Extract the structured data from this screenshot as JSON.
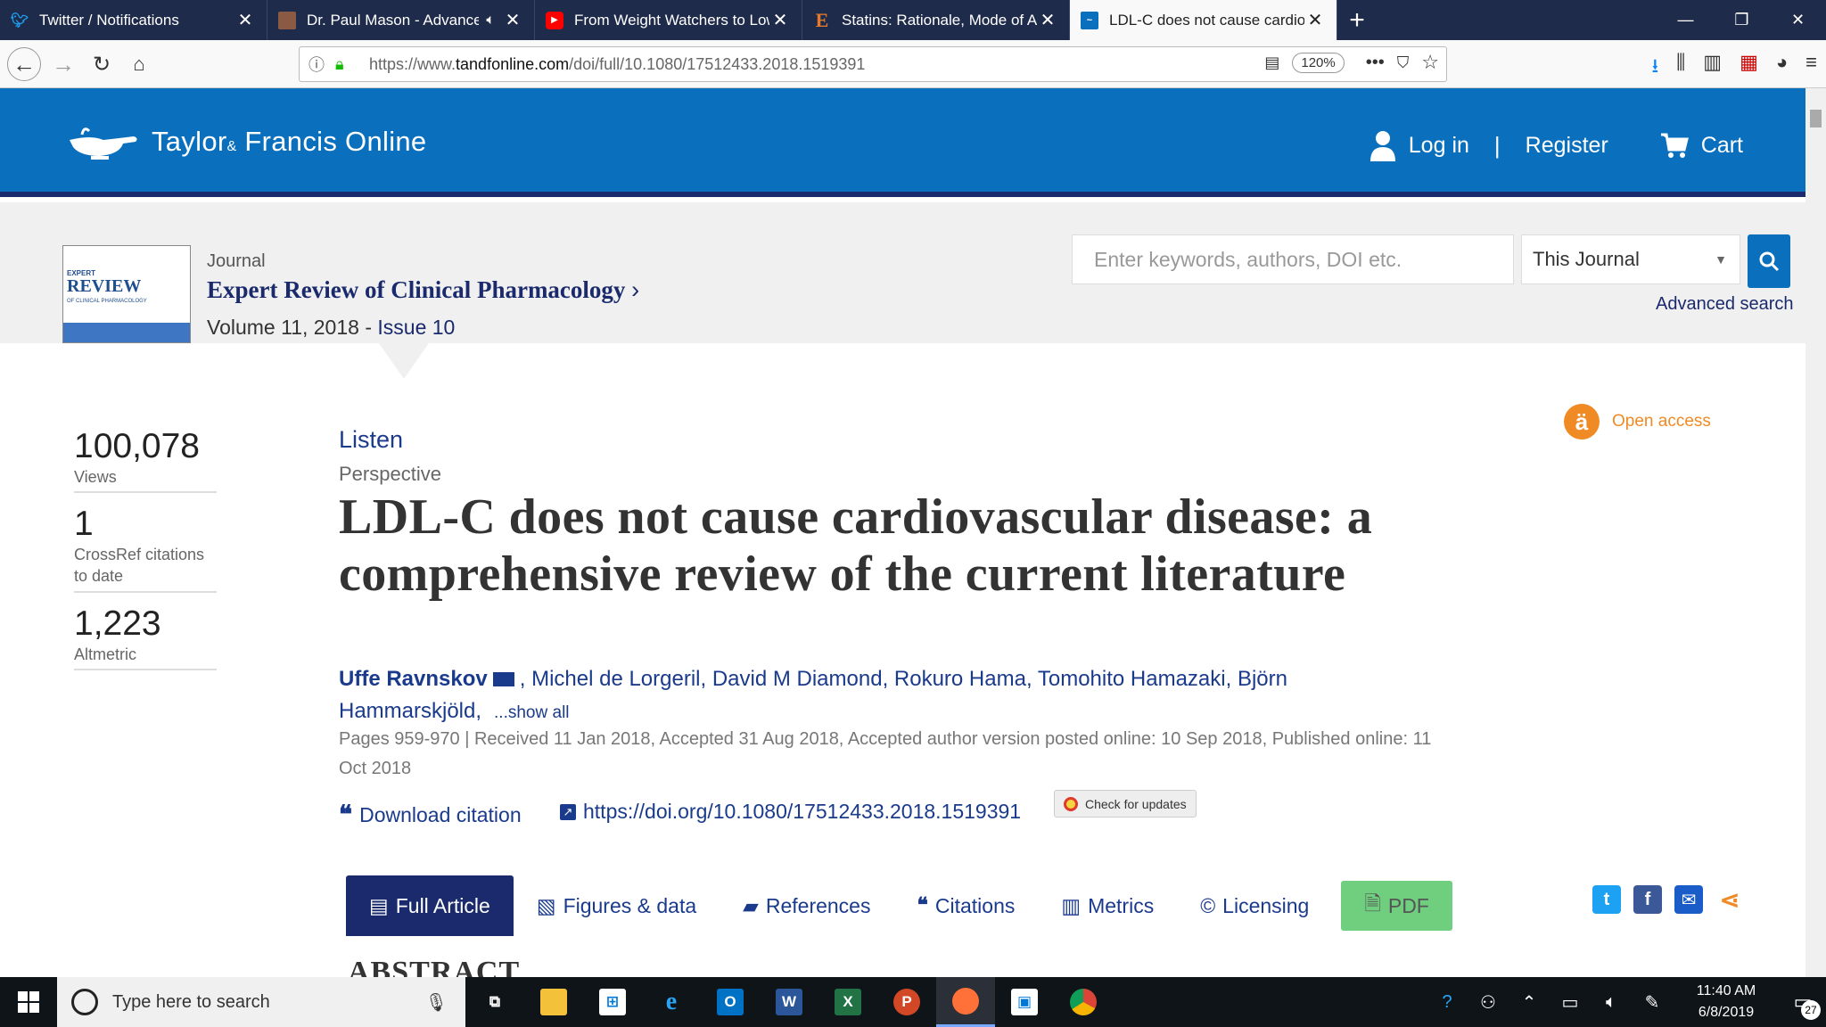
{
  "browser": {
    "tabs": [
      {
        "title": "Twitter / Notifications",
        "icon": "twitter-icon",
        "active": false,
        "audio": false
      },
      {
        "title": "Dr. Paul Mason - Advanced",
        "icon": "youtube-thumb-icon",
        "active": false,
        "audio": true
      },
      {
        "title": "From Weight Watchers to Low",
        "icon": "youtube-icon",
        "active": false,
        "audio": false
      },
      {
        "title": "Statins: Rationale, Mode of Acti",
        "icon": "e-site-icon",
        "active": false,
        "audio": false
      },
      {
        "title": "LDL-C does not cause cardiova",
        "icon": "tandf-icon",
        "active": true,
        "audio": false
      }
    ],
    "url_prefix": "https://www.",
    "url_domain": "tandfonline.com",
    "url_path": "/doi/full/10.1080/17512433.2018.1519391",
    "zoom": "120%"
  },
  "site": {
    "brand": "Taylor",
    "brand_amp": "&",
    "brand_rest": "Francis Online",
    "login": "Log in",
    "register": "Register",
    "cart": "Cart",
    "header_color": "#0a70bd"
  },
  "journal": {
    "label": "Journal",
    "name": "Expert Review of Clinical Pharmacology",
    "volume": "Volume 11, 2018",
    "volume_sep": " - ",
    "issue": "Issue 10",
    "cover_small": "EXPERT",
    "cover_big": "REVIEW",
    "cover_sub": "OF CLINICAL PHARMACOLOGY"
  },
  "search": {
    "placeholder": "Enter keywords, authors, DOI etc.",
    "scope": "This Journal",
    "advanced": "Advanced search"
  },
  "metrics": [
    {
      "value": "100,078",
      "label": "Views"
    },
    {
      "value": "1",
      "label": "CrossRef citations to date"
    },
    {
      "value": "1,223",
      "label": "Altmetric"
    }
  ],
  "article": {
    "listen": "Listen",
    "type": "Perspective",
    "title": "LDL-C does not cause cardiovascular disease: a comprehensive review of the current literature",
    "open_access": "Open access",
    "first_author": "Uffe Ravnskov",
    "authors_rest": ", Michel de Lorgeril, David M Diamond, Rokuro Hama, Tomohito Hamazaki, Björn Hammarskjöld,",
    "show_all": "...show all",
    "pub_info": "Pages 959-970 | Received 11 Jan 2018, Accepted 31 Aug 2018, Accepted author version posted online: 10 Sep 2018, Published online: 11 Oct 2018",
    "download_citation": "Download citation",
    "doi": "https://doi.org/10.1080/17512433.2018.1519391",
    "check_updates": "Check for updates"
  },
  "article_tabs": [
    {
      "label": "Full Article",
      "icon": "document-icon",
      "active": true
    },
    {
      "label": "Figures & data",
      "icon": "image-icon",
      "active": false
    },
    {
      "label": "References",
      "icon": "book-icon",
      "active": false
    },
    {
      "label": "Citations",
      "icon": "quote-icon",
      "active": false
    },
    {
      "label": "Metrics",
      "icon": "bar-chart-icon",
      "active": false
    },
    {
      "label": "Licensing",
      "icon": "copyright-icon",
      "active": false
    },
    {
      "label": "PDF",
      "icon": "pdf-icon",
      "active": false
    }
  ],
  "abstract_heading": "ABSTRACT",
  "taskbar": {
    "search_placeholder": "Type here to search",
    "time": "11:40 AM",
    "date": "6/8/2019",
    "notifications": "27"
  }
}
